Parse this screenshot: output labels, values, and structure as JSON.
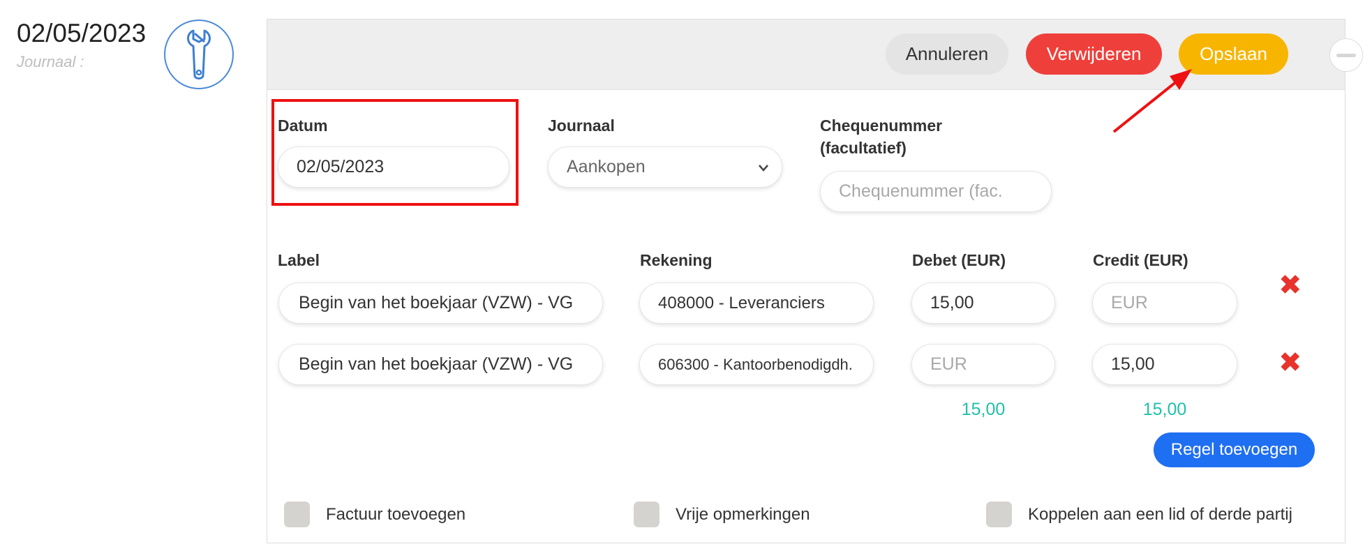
{
  "header": {
    "date": "02/05/2023",
    "journal_label": "Journaal :",
    "icon": "wrench-icon"
  },
  "toolbar": {
    "cancel_label": "Annuleren",
    "delete_label": "Verwijderen",
    "save_label": "Opslaan"
  },
  "form": {
    "date_label": "Datum",
    "date_value": "02/05/2023",
    "journal_label": "Journaal",
    "journal_value": "Aankopen",
    "cheque_label_line1": "Chequenummer",
    "cheque_label_line2": "(facultatief)",
    "cheque_placeholder": "Chequenummer (fac."
  },
  "table": {
    "headers": {
      "label": "Label",
      "account": "Rekening",
      "debit": "Debet (EUR)",
      "credit": "Credit (EUR)"
    },
    "rows": [
      {
        "label": "Begin van het boekjaar (VZW) - VG",
        "account": "408000 - Leveranciers",
        "debit": "15,00",
        "credit": "",
        "credit_placeholder": "EUR"
      },
      {
        "label": "Begin van het boekjaar (VZW) - VG",
        "account": "606300 - Kantoorbenodigdh.",
        "debit": "",
        "debit_placeholder": "EUR",
        "credit": "15,00"
      }
    ],
    "total_debit": "15,00",
    "total_credit": "15,00",
    "add_row_label": "Regel toevoegen"
  },
  "options": {
    "add_invoice": "Factuur toevoegen",
    "free_remarks": "Vrije opmerkingen",
    "link_member": "Koppelen aan een lid of derde partij"
  },
  "colors": {
    "delete": "#ef3f3a",
    "save": "#f7b500",
    "add_row": "#1f6ff2",
    "totals": "#20c0a8",
    "annotation": "#ee1111"
  }
}
